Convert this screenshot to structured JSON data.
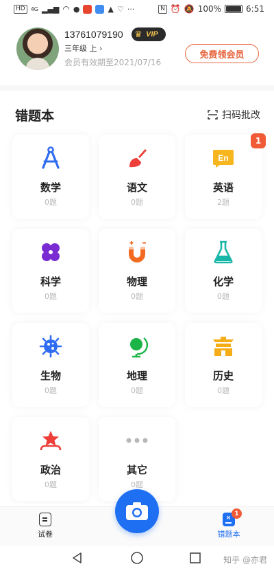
{
  "statusbar": {
    "left_chip": "HD",
    "signal_text": "4G",
    "right_chip": "N",
    "battery": "100%",
    "time": "6:51"
  },
  "profile": {
    "phone": "13761079190",
    "vip_label": "VIP",
    "grade": "三年级 上 ›",
    "expiry": "会员有效期至2021/07/16",
    "free_button": "免费领会员"
  },
  "section": {
    "title": "错题本",
    "scan_label": "扫码批改"
  },
  "subjects": [
    {
      "name": "数学",
      "count": "0题",
      "icon": "compass-icon",
      "color": "#2f6cf2",
      "badge": ""
    },
    {
      "name": "语文",
      "count": "0题",
      "icon": "brush-icon",
      "color": "#ee3e3a",
      "badge": ""
    },
    {
      "name": "英语",
      "count": "2题",
      "icon": "english-bubble-icon",
      "color": "#f7b51e",
      "badge": "1"
    },
    {
      "name": "科学",
      "count": "0题",
      "icon": "atom-icon",
      "color": "#7a2bd1",
      "badge": ""
    },
    {
      "name": "物理",
      "count": "0题",
      "icon": "magnet-icon",
      "color": "#f36b21",
      "badge": ""
    },
    {
      "name": "化学",
      "count": "0题",
      "icon": "flask-icon",
      "color": "#19b7a7",
      "badge": ""
    },
    {
      "name": "生物",
      "count": "0题",
      "icon": "virus-icon",
      "color": "#2f6cf2",
      "badge": ""
    },
    {
      "name": "地理",
      "count": "0题",
      "icon": "globe-icon",
      "color": "#1bb446",
      "badge": ""
    },
    {
      "name": "历史",
      "count": "0题",
      "icon": "temple-icon",
      "color": "#f5ad17",
      "badge": ""
    },
    {
      "name": "政治",
      "count": "0题",
      "icon": "star-badge-icon",
      "color": "#ee3e3a",
      "badge": ""
    },
    {
      "name": "其它",
      "count": "0题",
      "icon": "more-dots-icon",
      "color": "#b8b8b8",
      "badge": ""
    }
  ],
  "tabs": {
    "left_label": "试卷",
    "right_label": "错题本",
    "right_badge": "1",
    "active_color": "#1f6ff2"
  },
  "watermark": "知乎 @亦君"
}
